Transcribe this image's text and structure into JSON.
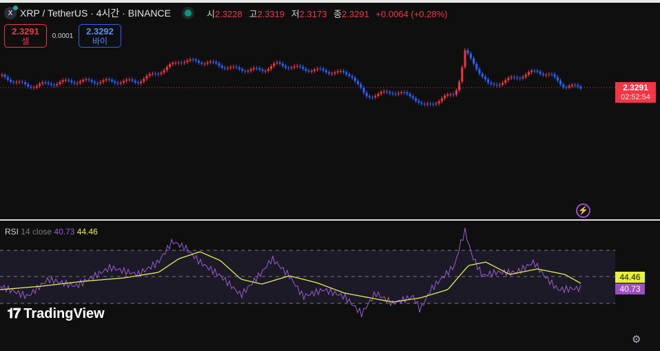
{
  "header": {
    "symbol_title": "XRP / TetherUS · 4시간 · BINANCE",
    "logo_text": "X",
    "ohlc": [
      {
        "k": "시",
        "v": "2.3228"
      },
      {
        "k": "고",
        "v": "2.3319"
      },
      {
        "k": "저",
        "v": "2.3173"
      },
      {
        "k": "종",
        "v": "2.3291"
      }
    ],
    "change": "+0.0064 (+0.28%)"
  },
  "trade": {
    "sell_price": "2.3291",
    "sell_label": "셀",
    "spread": "0.0001",
    "buy_price": "2.3292",
    "buy_label": "바이"
  },
  "price_scale": {
    "last_price": "2.3291",
    "countdown": "02:52:54"
  },
  "rsi": {
    "label": "RSI",
    "params": "14 close",
    "value": "40.73",
    "ma_value": "44.46"
  },
  "brand": "TradingView",
  "colors": {
    "up": "#089981",
    "down": "#f23645",
    "bull_candle": "#f23645",
    "bear_candle": "#2962ff",
    "rsi": "#9c5cd6",
    "rsi_ma": "#e6f04d"
  }
}
